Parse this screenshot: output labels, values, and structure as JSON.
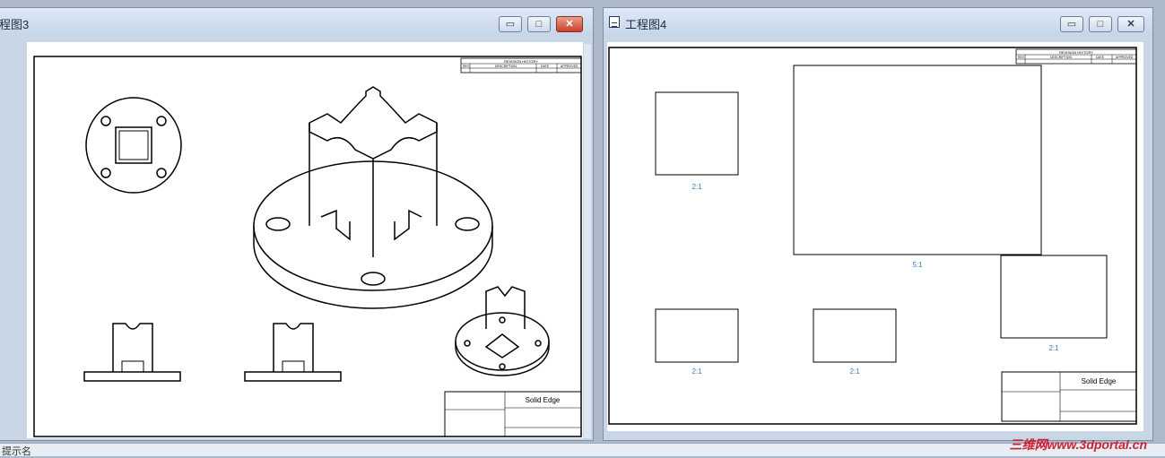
{
  "left_window": {
    "title": "程图3",
    "buttons": {
      "minimize": "▭",
      "maximize": "□",
      "close": "✕"
    },
    "title_block": {
      "brand": "Solid Edge",
      "revision_header": "REVISION HISTORY",
      "rev_cols": [
        "REV",
        "DESCRIPTION",
        "DATE",
        "APPROVED"
      ]
    }
  },
  "right_window": {
    "title": "工程图4",
    "buttons": {
      "minimize": "▭",
      "maximize": "□",
      "close": "✕"
    },
    "view_scales": [
      "2:1",
      "5:1",
      "2:1",
      "2:1",
      "2:1"
    ],
    "title_block": {
      "brand": "Solid Edge",
      "revision_header": "REVISION HISTORY",
      "rev_cols": [
        "REV",
        "DESCRIPTION",
        "DATE",
        "APPROVED"
      ]
    }
  },
  "status_bar": {
    "text": "提示名"
  },
  "watermark": {
    "text": "三维网www.3dportal.cn"
  }
}
